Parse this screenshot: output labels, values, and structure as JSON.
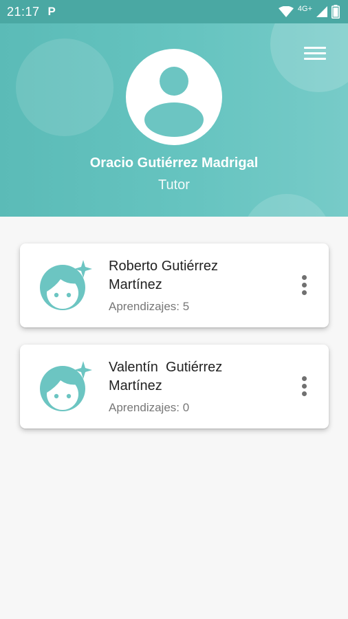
{
  "status_bar": {
    "time": "21:17",
    "app_indicator": "P",
    "network": "4G+",
    "icons": [
      "wifi-icon",
      "signal-icon",
      "battery-icon"
    ]
  },
  "header": {
    "profile_name": "Oracio Gutiérrez Madrigal",
    "profile_role": "Tutor",
    "menu_icon": "hamburger-menu-icon",
    "avatar_icon": "person-icon",
    "colors": {
      "header_start": "#5bbbb7",
      "header_end": "#77cbc8",
      "accent": "#6cc5c2"
    }
  },
  "children": [
    {
      "name_line1": "Roberto Gutiérrez",
      "name_line2": "Martínez",
      "count_text": "Aprendizajes: 5",
      "icon": "child-face-icon"
    },
    {
      "name_line1": "Valentín  Gutiérrez",
      "name_line2": "Martínez",
      "count_text": "Aprendizajes: 0",
      "icon": "child-face-icon"
    }
  ]
}
